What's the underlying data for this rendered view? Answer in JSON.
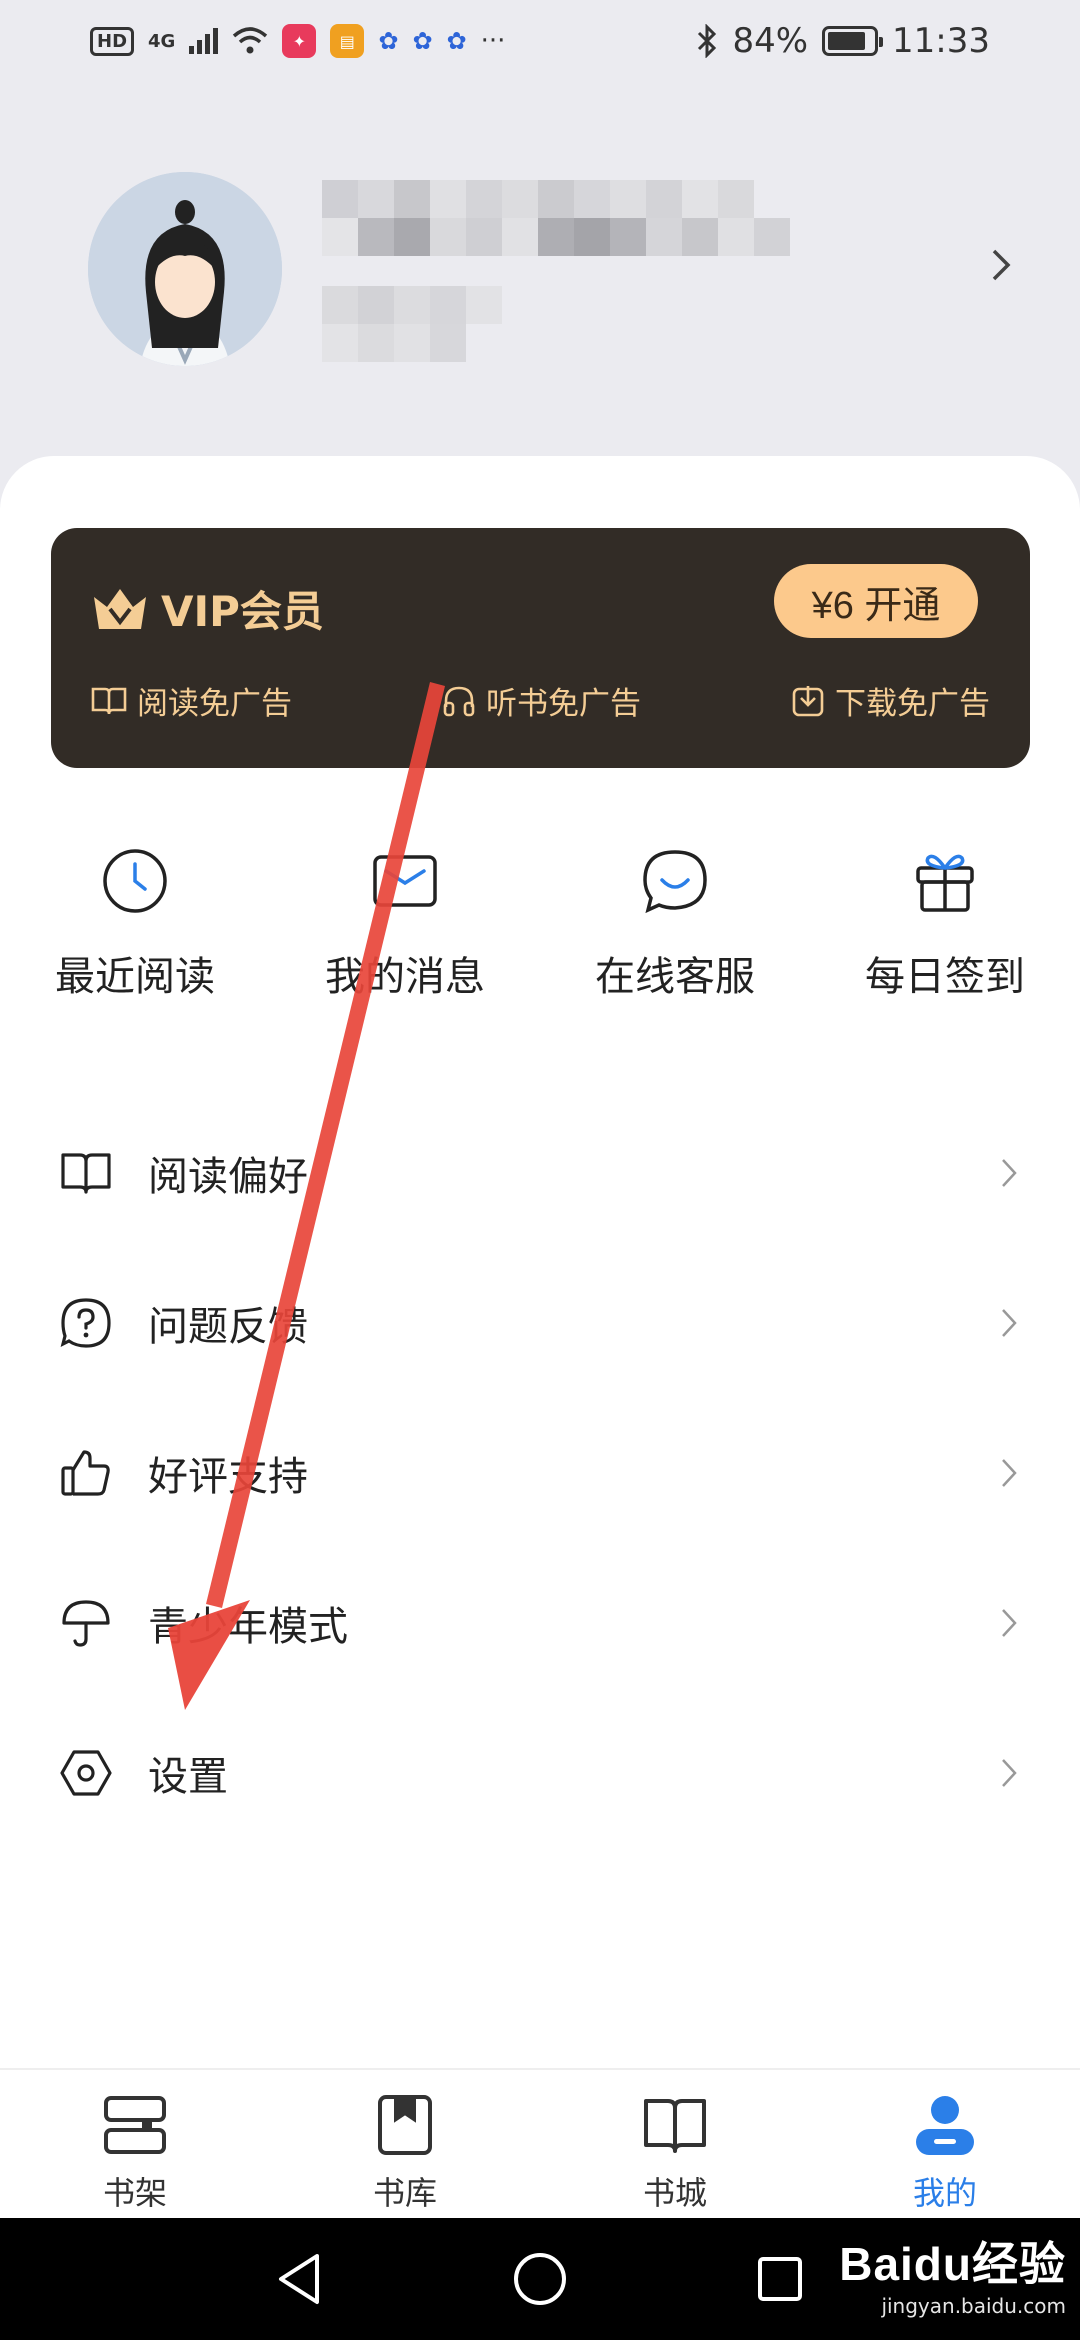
{
  "status_bar": {
    "network": "HD",
    "signal_type": "4G",
    "battery": "84%",
    "battery_level": 0.84,
    "time": "11:33"
  },
  "profile": {
    "name_blurred": true
  },
  "vip": {
    "title": "VIP会员",
    "button_label": "¥6 开通",
    "perks": [
      {
        "label": "阅读免广告",
        "icon": "book-open-icon"
      },
      {
        "label": "听书免广告",
        "icon": "headphones-icon"
      },
      {
        "label": "下载免广告",
        "icon": "download-icon"
      }
    ],
    "colors": {
      "card": "#322c26",
      "gold": "#f4cd95",
      "button": "#fcc98c"
    }
  },
  "quick_actions": [
    {
      "label": "最近阅读",
      "icon": "clock-icon"
    },
    {
      "label": "我的消息",
      "icon": "envelope-icon"
    },
    {
      "label": "在线客服",
      "icon": "chat-smile-icon"
    },
    {
      "label": "每日签到",
      "icon": "gift-icon"
    }
  ],
  "menu": [
    {
      "label": "阅读偏好",
      "icon": "book-icon"
    },
    {
      "label": "问题反馈",
      "icon": "question-icon"
    },
    {
      "label": "好评支持",
      "icon": "thumbs-up-icon"
    },
    {
      "label": "青少年模式",
      "icon": "umbrella-icon"
    },
    {
      "label": "设置",
      "icon": "settings-hexagon-icon"
    }
  ],
  "tabbar": [
    {
      "label": "书架",
      "icon": "bookshelf-icon",
      "active": false
    },
    {
      "label": "书库",
      "icon": "library-icon",
      "active": false
    },
    {
      "label": "书城",
      "icon": "bookstore-icon",
      "active": false
    },
    {
      "label": "我的",
      "icon": "profile-icon",
      "active": true
    }
  ],
  "watermark": {
    "logo": "Baidu经验",
    "url": "jingyan.baidu.com"
  },
  "annotation": {
    "arrow_color": "#e8453a"
  }
}
